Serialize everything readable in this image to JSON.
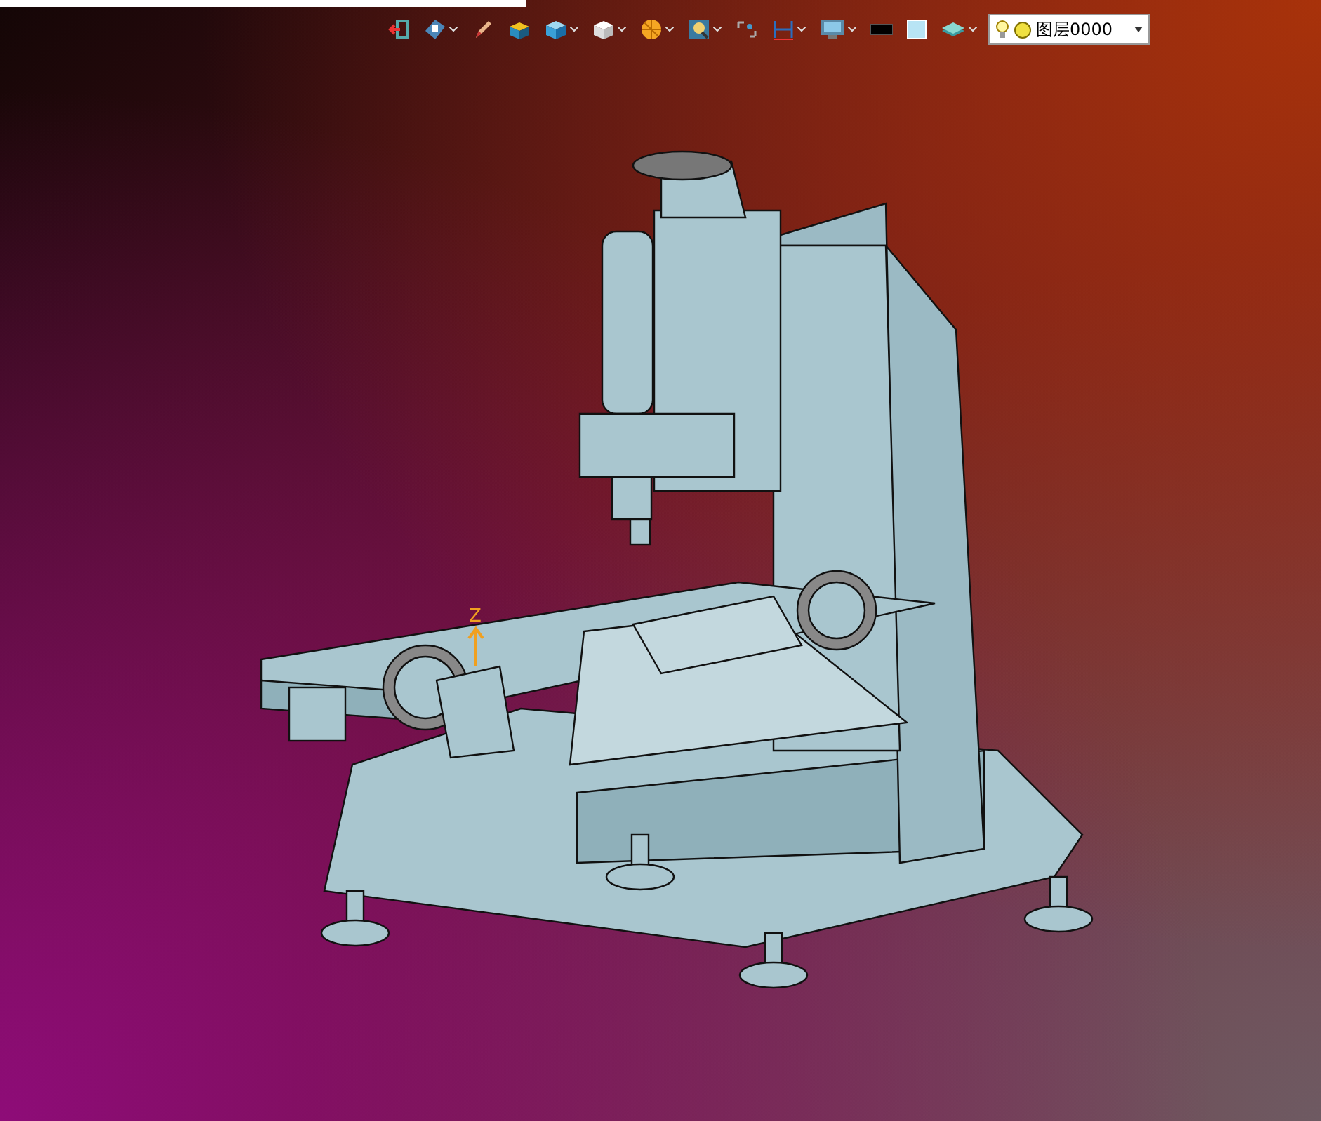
{
  "toolbar": [
    {
      "kind": "exit",
      "has_dropdown": false
    },
    {
      "kind": "view",
      "has_dropdown": true
    },
    {
      "kind": "pencil",
      "has_dropdown": false
    },
    {
      "kind": "box",
      "has_dropdown": false
    },
    {
      "kind": "cube",
      "has_dropdown": true
    },
    {
      "kind": "wirecube",
      "has_dropdown": true
    },
    {
      "kind": "render",
      "has_dropdown": true
    },
    {
      "kind": "zoom",
      "has_dropdown": true
    },
    {
      "kind": "select",
      "has_dropdown": false
    },
    {
      "kind": "dimension",
      "has_dropdown": true
    },
    {
      "kind": "monitor",
      "has_dropdown": true
    },
    {
      "kind": "linecolor",
      "has_dropdown": false
    },
    {
      "kind": "fillcolor",
      "has_dropdown": false
    },
    {
      "kind": "layers",
      "has_dropdown": true
    }
  ],
  "layer_selector": {
    "label": "图层0000",
    "visible": true
  },
  "viewport": {
    "axis_label": "Z"
  }
}
